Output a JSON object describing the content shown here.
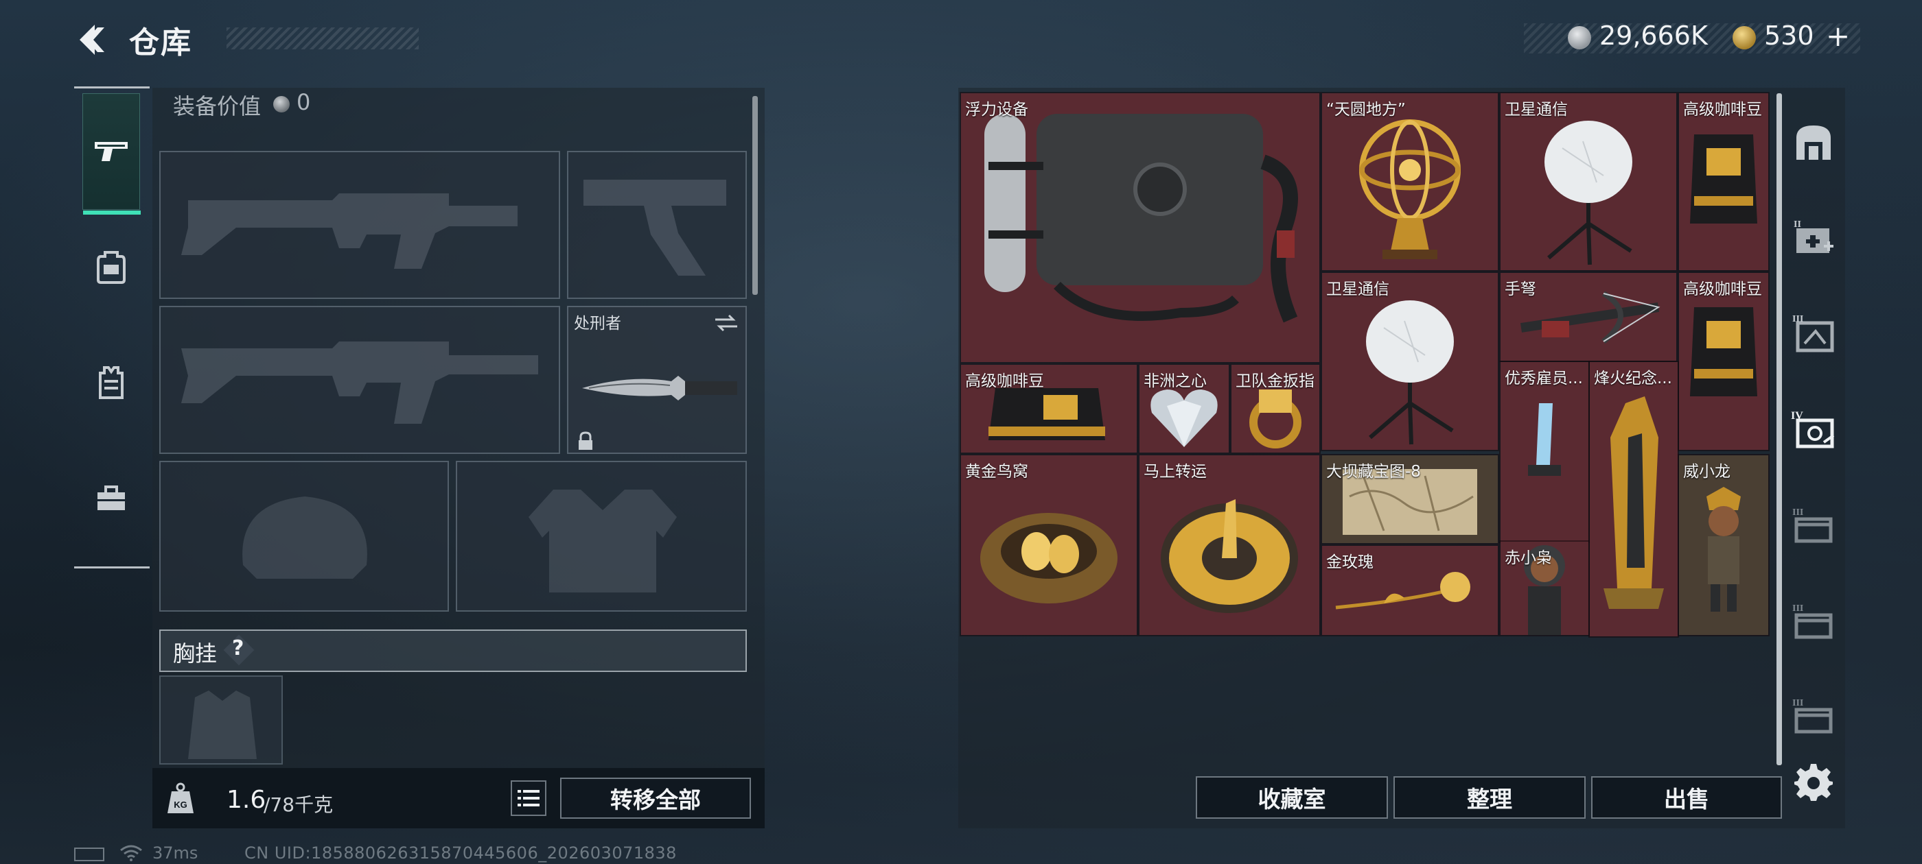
{
  "header": {
    "title": "仓库",
    "coin_amount": "29,666K",
    "premium_amount": "530",
    "premium_plus": "+"
  },
  "equipment": {
    "value_label": "装备价值",
    "value": "0",
    "melee_slot": {
      "name": "处刑者",
      "locked": true
    },
    "chest_rig_label": "胸挂",
    "help_label": "?",
    "weight_current": "1.6",
    "weight_max": "/78千克",
    "weight_icon_label": "KG",
    "transfer_all_label": "转移全部"
  },
  "stash": {
    "items": [
      {
        "name": "浮力设备",
        "bg": "#5a2a31"
      },
      {
        "name": "“天圆地方”",
        "bg": "#5a2a31"
      },
      {
        "name": "卫星通信",
        "bg": "#5a2a31"
      },
      {
        "name": "高级咖啡豆",
        "bg": "#5a2a31"
      },
      {
        "name": "卫星通信",
        "bg": "#5a2a31"
      },
      {
        "name": "手弩",
        "bg": "#5a2a31"
      },
      {
        "name": "高级咖啡豆",
        "bg": "#5a2a31"
      },
      {
        "name": "高级咖啡豆",
        "bg": "#5a2a31"
      },
      {
        "name": "非洲之心",
        "bg": "#5a2a31"
      },
      {
        "name": "卫队金扳指",
        "bg": "#5a2a31"
      },
      {
        "name": "优秀雇员...",
        "bg": "#5a2a31"
      },
      {
        "name": "烽火纪念...",
        "bg": "#5a2a31"
      },
      {
        "name": "黄金鸟窝",
        "bg": "#5a2a31"
      },
      {
        "name": "马上转运",
        "bg": "#5a2a31"
      },
      {
        "name": "大坝藏宝图-8",
        "bg": "#4a3f33"
      },
      {
        "name": "赤小枭",
        "bg": "#5a2a31"
      },
      {
        "name": "威小龙",
        "bg": "#4a3f33"
      },
      {
        "name": "金玫瑰",
        "bg": "#5a2a31"
      }
    ],
    "vault_label": "收藏室",
    "sort_label": "整理",
    "sell_label": "出售"
  },
  "right_categories": [
    {
      "icon": "safehouse-icon"
    },
    {
      "icon": "medical-case-icon",
      "tier": "II"
    },
    {
      "icon": "tier3-case-icon",
      "tier": "III"
    },
    {
      "icon": "tier4-case-icon",
      "tier": "IV"
    },
    {
      "icon": "tier3-box-icon",
      "tier": "III"
    },
    {
      "icon": "tier3-box-icon",
      "tier": "III"
    },
    {
      "icon": "tier3-box-icon",
      "tier": "III"
    }
  ],
  "status": {
    "ping": "37ms",
    "uid": "CN UID:18588062631587044​5606_202603071838"
  },
  "colors": {
    "accent_green": "#3fe0b6",
    "item_red": "#5a2a31",
    "item_brown": "#4a3f33"
  }
}
